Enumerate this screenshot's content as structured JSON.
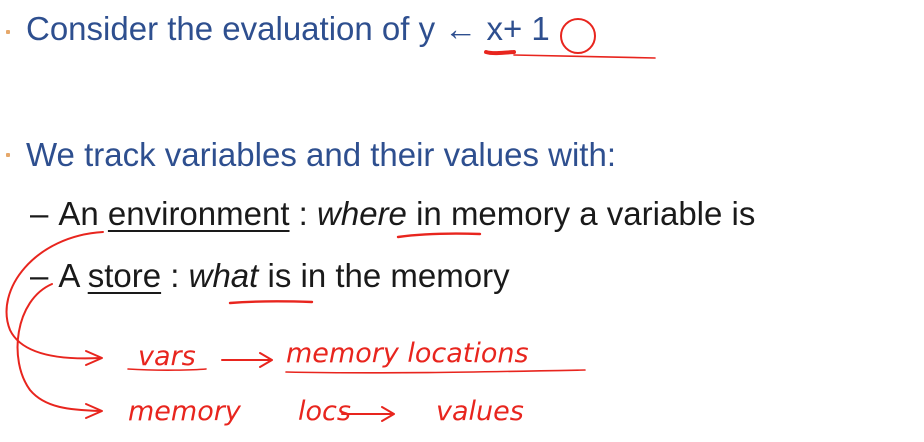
{
  "slide": {
    "line1": {
      "prefix": "Consider the evaluation of ",
      "var_y": "y",
      "arrow": "←",
      "var_x": "x",
      "suffix": "+ 1"
    },
    "line2": "We track variables and their values with:",
    "item1": {
      "dash": "–",
      "lead": "An ",
      "term": "environment",
      "sep": " : ",
      "emph": "where",
      "rest": " in memory a variable is"
    },
    "item2": {
      "dash": "–",
      "lead": "A ",
      "term": "store",
      "sep": " : ",
      "emph": "what",
      "rest": " is in the memory"
    }
  },
  "annotations": {
    "vars": "vars",
    "memory_locations": "memory locations",
    "memory": "memory",
    "locs": "locs",
    "values": "values",
    "ink_color": "#e8251e",
    "text_color": "#2e4f8f"
  }
}
